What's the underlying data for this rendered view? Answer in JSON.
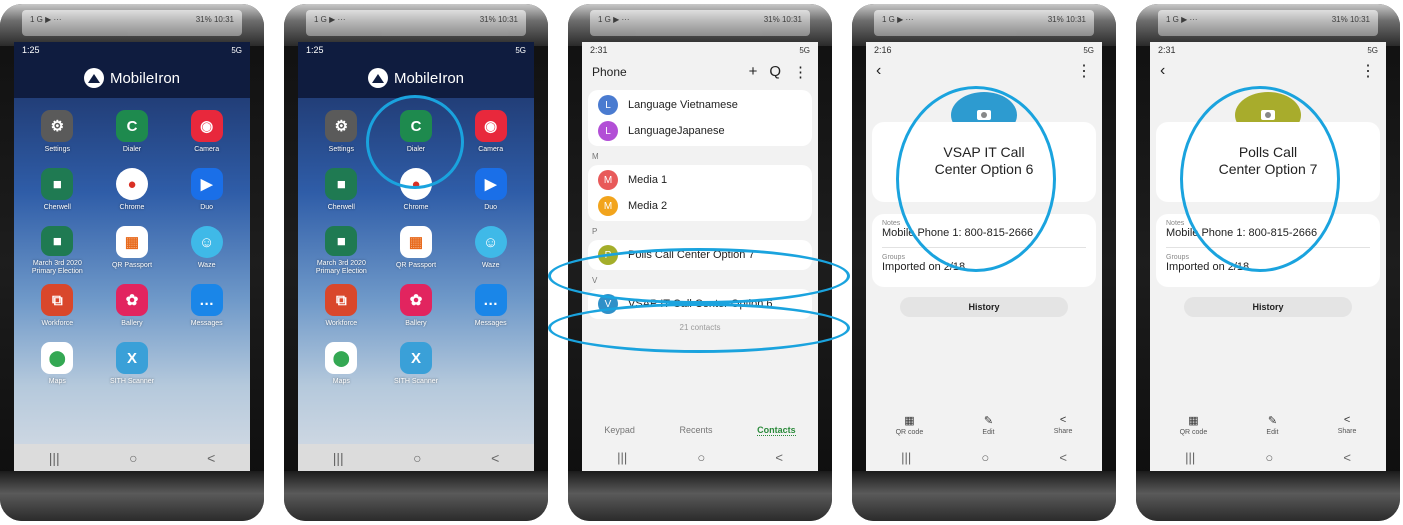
{
  "outer": {
    "status_left": "1 G ▶ ···",
    "status_right": "31% 10:31"
  },
  "home": {
    "time": "1:25",
    "signal": "5G",
    "header_title": "MobileIron",
    "apps": [
      {
        "label": "Settings",
        "color": "#5a5a5a",
        "icon": "gear-icon",
        "glyph": "⚙"
      },
      {
        "label": "Dialer",
        "color": "#1e8a4e",
        "icon": "phone-icon",
        "glyph": "C"
      },
      {
        "label": "Camera",
        "color": "#e8283c",
        "icon": "camera-icon",
        "glyph": "◉"
      },
      {
        "label": "Cherwell",
        "color": "#1f7a52",
        "icon": "briefcase-icon",
        "glyph": "■"
      },
      {
        "label": "Chrome",
        "color": "#ffffff",
        "icon": "chrome-icon",
        "glyph": "●"
      },
      {
        "label": "Duo",
        "color": "#1a6fe8",
        "icon": "video-icon",
        "glyph": "▶"
      },
      {
        "label": "March 3rd 2020 Primary Election",
        "color": "#1f7a52",
        "icon": "briefcase-icon",
        "glyph": "■"
      },
      {
        "label": "QR Passport",
        "color": "#ffffff",
        "icon": "qr-passport-icon",
        "glyph": "▦"
      },
      {
        "label": "Waze",
        "color": "#3fb9e8",
        "icon": "waze-icon",
        "glyph": "☺"
      },
      {
        "label": "Workforce",
        "color": "#d9472b",
        "icon": "workforce-icon",
        "glyph": "⧉"
      },
      {
        "label": "Ballery",
        "color": "#e2245f",
        "icon": "flower-icon",
        "glyph": "✿"
      },
      {
        "label": "Messages",
        "color": "#1a86e8",
        "icon": "messages-icon",
        "glyph": "…"
      },
      {
        "label": "Maps",
        "color": "#ffffff",
        "icon": "maps-pin-icon",
        "glyph": "⬤"
      },
      {
        "label": "SITH Scanner",
        "color": "#3aa0d8",
        "icon": "scanner-icon",
        "glyph": "X"
      }
    ],
    "nav": [
      "|||",
      "○",
      "<"
    ]
  },
  "contacts": {
    "time": "2:31",
    "title": "Phone",
    "actions": [
      "+",
      "Q",
      "⋮"
    ],
    "top_rows": [
      {
        "initial": "L",
        "name": "Language Vietnamese",
        "color": "#4a7bd0"
      },
      {
        "initial": "L",
        "name": "LanguageJapanese",
        "color": "#b24fd6"
      }
    ],
    "section_m": "M",
    "m_rows": [
      {
        "initial": "M",
        "name": "Media 1",
        "color": "#e85a5a"
      },
      {
        "initial": "M",
        "name": "Media 2",
        "color": "#f2a41c"
      }
    ],
    "section_p": "P",
    "p_rows": [
      {
        "initial": "P",
        "name": "Polls Call Center Option 7",
        "color": "#a4ae2a"
      }
    ],
    "section_v": "V",
    "v_rows": [
      {
        "initial": "V",
        "name": "VSAP IT Call Center Option 6",
        "color": "#3090c8"
      }
    ],
    "count": "21 contacts",
    "tabs": [
      "Keypad",
      "Recents",
      "Contacts"
    ],
    "nav": [
      "|||",
      "○",
      "<"
    ]
  },
  "details": [
    {
      "time": "2:16",
      "name_line1": "VSAP IT Call",
      "name_line2": "Center Option 6",
      "photo_color": "#2d9bd0",
      "notes_label": "Notes",
      "notes_value": "Mobile Phone 1: 800-815-2666",
      "groups_label": "Groups",
      "groups_value": "Imported on 2/18",
      "history": "History",
      "actions": [
        "QR code",
        "Edit",
        "Share"
      ],
      "nav": [
        "|||",
        "○",
        "<"
      ]
    },
    {
      "time": "2:31",
      "name_line1": "Polls Call",
      "name_line2": "Center Option 7",
      "photo_color": "#a8ac2c",
      "notes_label": "Notes",
      "notes_value": "Mobile Phone 1: 800-815-2666",
      "groups_label": "Groups",
      "groups_value": "Imported on 2/18",
      "history": "History",
      "actions": [
        "QR code",
        "Edit",
        "Share"
      ],
      "nav": [
        "|||",
        "○",
        "<"
      ]
    }
  ],
  "highlight_color": "#1aa3de"
}
